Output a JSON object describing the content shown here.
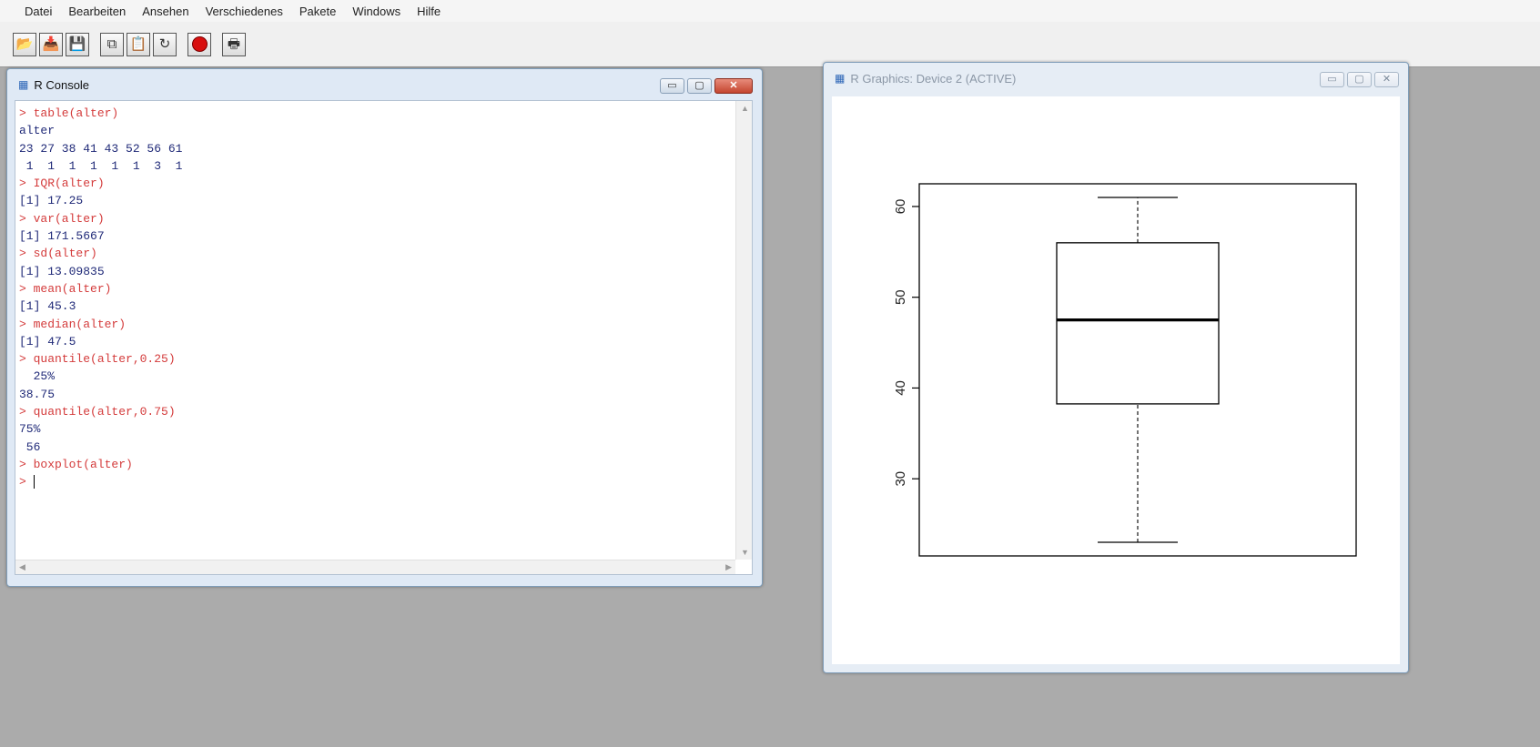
{
  "menu": [
    "Datei",
    "Bearbeiten",
    "Ansehen",
    "Verschiedenes",
    "Pakete",
    "Windows",
    "Hilfe"
  ],
  "toolbar": {
    "buttons": [
      {
        "name": "open-script-button",
        "icon": "folder-icon",
        "glyph": "📂"
      },
      {
        "name": "load-workspace-button",
        "icon": "load-icon",
        "glyph": "📥"
      },
      {
        "name": "save-workspace-button",
        "icon": "save-icon",
        "glyph": "💾"
      },
      {
        "name": "copy-button",
        "icon": "copy-icon",
        "glyph": "⧉"
      },
      {
        "name": "paste-button",
        "icon": "paste-icon",
        "glyph": "📋"
      },
      {
        "name": "copy-paste-button",
        "icon": "refresh-icon",
        "glyph": "↻"
      },
      {
        "name": "stop-button",
        "icon": "stop-icon",
        "glyph": ""
      },
      {
        "name": "print-button",
        "icon": "print-icon",
        "glyph": "🖶"
      }
    ]
  },
  "console": {
    "title": "R Console",
    "lines": [
      {
        "type": "in",
        "text": "> table(alter)"
      },
      {
        "type": "out",
        "text": "alter"
      },
      {
        "type": "out",
        "text": "23 27 38 41 43 52 56 61"
      },
      {
        "type": "out",
        "text": " 1  1  1  1  1  1  3  1"
      },
      {
        "type": "in",
        "text": "> IQR(alter)"
      },
      {
        "type": "out",
        "text": "[1] 17.25"
      },
      {
        "type": "in",
        "text": "> var(alter)"
      },
      {
        "type": "out",
        "text": "[1] 171.5667"
      },
      {
        "type": "in",
        "text": "> sd(alter)"
      },
      {
        "type": "out",
        "text": "[1] 13.09835"
      },
      {
        "type": "in",
        "text": "> mean(alter)"
      },
      {
        "type": "out",
        "text": "[1] 45.3"
      },
      {
        "type": "in",
        "text": "> median(alter)"
      },
      {
        "type": "out",
        "text": "[1] 47.5"
      },
      {
        "type": "in",
        "text": "> quantile(alter,0.25)"
      },
      {
        "type": "out",
        "text": "  25%"
      },
      {
        "type": "out",
        "text": "38.75"
      },
      {
        "type": "in",
        "text": "> quantile(alter,0.75)"
      },
      {
        "type": "out",
        "text": "75%"
      },
      {
        "type": "out",
        "text": " 56"
      },
      {
        "type": "in",
        "text": "> boxplot(alter)"
      }
    ],
    "prompt": "> "
  },
  "graphics": {
    "title": "R Graphics: Device 2 (ACTIVE)"
  },
  "chart_data": {
    "type": "boxplot",
    "min": 23,
    "q1": 38.25,
    "median": 47.5,
    "q3": 56,
    "max": 61,
    "ylim": [
      21.5,
      62.5
    ],
    "yticks": [
      "30",
      "40",
      "50",
      "60"
    ]
  }
}
